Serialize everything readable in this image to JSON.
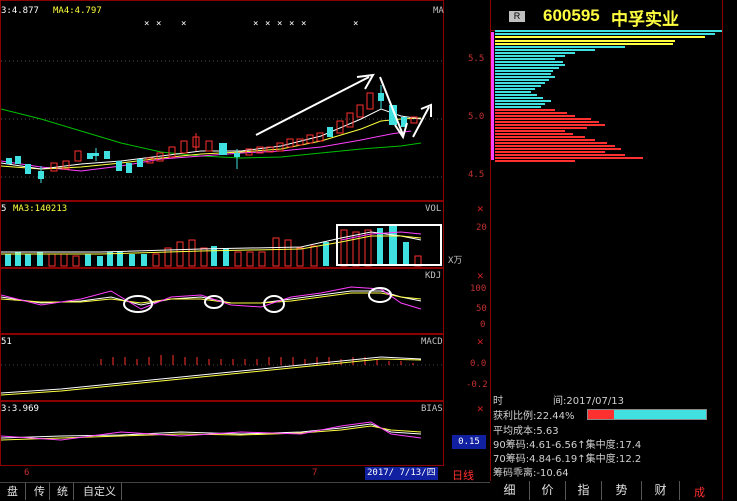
{
  "stock": {
    "badge": "R",
    "code": "600595",
    "name": "中孚实业"
  },
  "main_panel": {
    "ma3": "3:4.877",
    "ma4": "MA4:4.797",
    "ma_label": "MA",
    "x_marks": [
      "×",
      "×",
      "×",
      "×",
      "×",
      "×",
      "×",
      "×",
      "×"
    ],
    "price_ticks": [
      "5.5",
      "5.0",
      "4.5"
    ]
  },
  "vol_panel": {
    "prefix": "5",
    "ma3": "MA3:140213",
    "label": "VOL",
    "tick": "20",
    "unit": "X万"
  },
  "kdj_panel": {
    "label": "KDJ",
    "ticks": [
      "100",
      "50",
      "0"
    ]
  },
  "macd_panel": {
    "prefix": "51",
    "label": "MACD",
    "ticks": [
      "0.0",
      "-0.2"
    ]
  },
  "bias_panel": {
    "prefix": "3:3.969",
    "label": "BIAS",
    "value": "0.15"
  },
  "x_axis": {
    "label_6": "6",
    "label_7": "7",
    "date": "2017/ 7/13/四",
    "period": "日线"
  },
  "chip_info": {
    "time_label": "时",
    "time_value": "间:2017/07/13",
    "profit_label": "获利比例:22.44%",
    "avg_cost": "平均成本:5.63",
    "r90": "90筹码:4.61-6.56↑集中度:17.4",
    "r70": "70筹码:4.84-6.19↑集中度:12.2",
    "diff": "筹码乖离:-10.64",
    "profit_ratio": 0.2244
  },
  "right_tabs": [
    "细",
    "价",
    "指",
    "势",
    "财"
  ],
  "left_tabs": [
    "盘",
    "传",
    "统",
    "自定义"
  ],
  "corner_label": "成",
  "colors": {
    "up": "#ff3030",
    "down": "#40e0e0",
    "frame": "#8b0000",
    "ma_white": "#ffffff",
    "ma_yellow": "#ffff40",
    "ma_purple": "#ff40ff",
    "ma_green": "#00c000"
  }
}
